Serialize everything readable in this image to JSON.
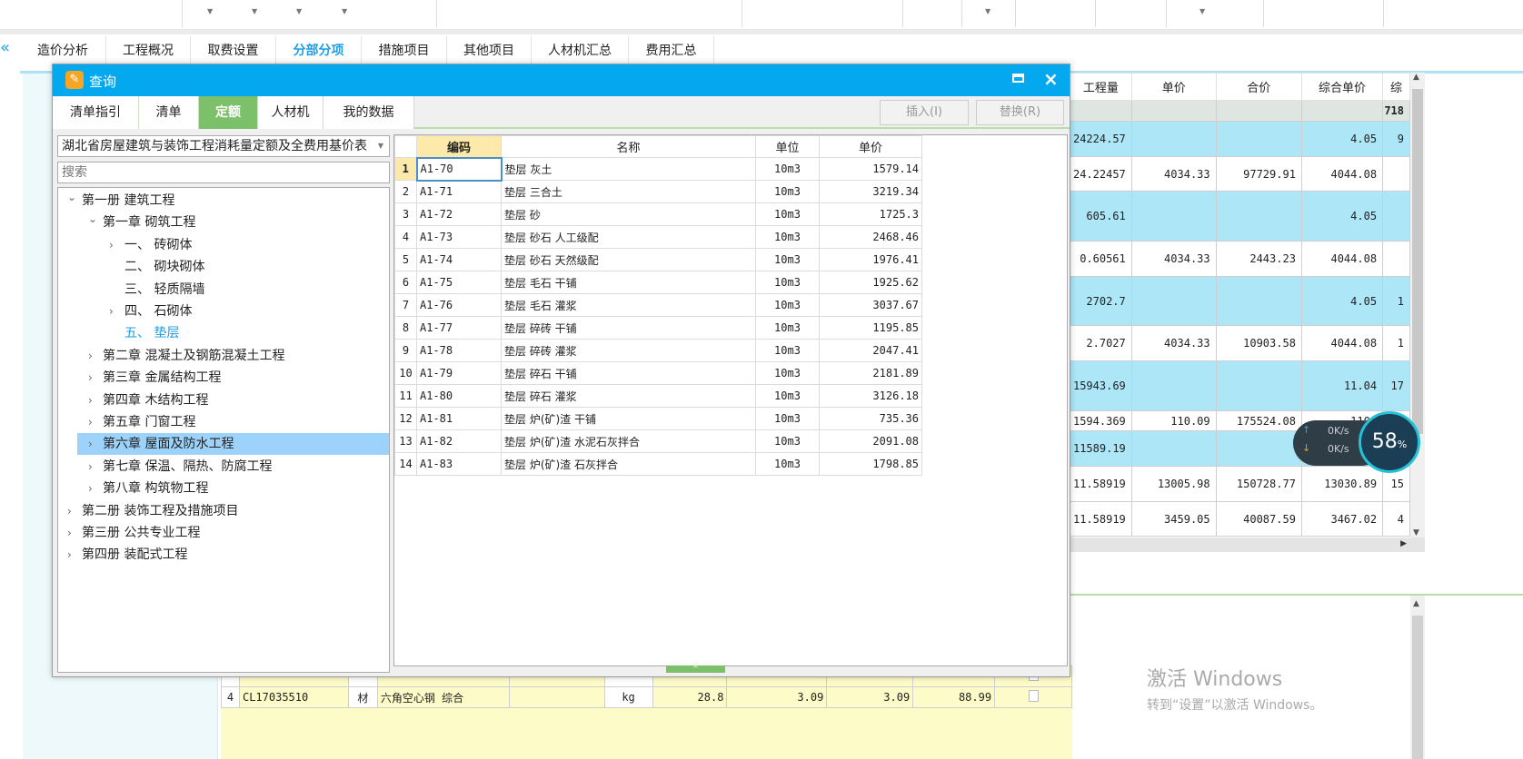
{
  "main_tabs": [
    "造价分析",
    "工程概况",
    "取费设置",
    "分部分项",
    "措施项目",
    "其他项目",
    "人材机汇总",
    "费用汇总"
  ],
  "active_main_tab": "分部分项",
  "right_table": {
    "headers": [
      "工程量",
      "单价",
      "合价",
      "综合单价",
      "综"
    ],
    "rows": [
      {
        "style": "g",
        "cells": [
          "",
          "",
          "",
          "",
          "718"
        ]
      },
      {
        "style": "b",
        "cells": [
          "24224.57",
          "",
          "",
          "4.05",
          "9"
        ]
      },
      {
        "style": "w",
        "cells": [
          "24.22457",
          "4034.33",
          "97729.91",
          "4044.08",
          ""
        ]
      },
      {
        "style": "b",
        "cells": [
          "605.61",
          "",
          "",
          "4.05",
          ""
        ]
      },
      {
        "style": "w",
        "cells": [
          "0.60561",
          "4034.33",
          "2443.23",
          "4044.08",
          ""
        ]
      },
      {
        "style": "b",
        "cells": [
          "2702.7",
          "",
          "",
          "4.05",
          "1"
        ]
      },
      {
        "style": "w",
        "cells": [
          "2.7027",
          "4034.33",
          "10903.58",
          "4044.08",
          "1"
        ]
      },
      {
        "style": "b",
        "cells": [
          "15943.69",
          "",
          "",
          "11.04",
          "17"
        ]
      },
      {
        "style": "w",
        "cells": [
          "1594.369",
          "110.09",
          "175524.08",
          "110.",
          ""
        ]
      },
      {
        "style": "b",
        "cells": [
          "11589.19",
          "",
          "",
          "",
          ""
        ]
      },
      {
        "style": "w",
        "cells": [
          "11.58919",
          "13005.98",
          "150728.77",
          "13030.89",
          "15"
        ]
      },
      {
        "style": "w",
        "cells": [
          "11.58919",
          "3459.05",
          "40087.59",
          "3467.02",
          "4"
        ]
      }
    ]
  },
  "bottom_table": {
    "rows": [
      {
        "cells": [
          "",
          "",
          "",
          "",
          "",
          "",
          "",
          "",
          "",
          ""
        ]
      },
      {
        "cells": [
          "4",
          "CL17035510",
          "材",
          "六角空心钢 综合",
          "",
          "kg",
          "28.8",
          "3.09",
          "3.09",
          "88.99"
        ]
      }
    ]
  },
  "net_monitor": {
    "upload": "0K/s",
    "download": "0K/s",
    "percent": "58",
    "percent_sign": "%"
  },
  "watermark": {
    "title": "激活 Windows",
    "subtitle": "转到“设置”以激活 Windows。"
  },
  "dialog": {
    "title": "查询",
    "tabs": [
      "清单指引",
      "清单",
      "定额",
      "人材机",
      "我的数据"
    ],
    "active_tab": "定额",
    "insert_button": "插入(I)",
    "replace_button": "替换(R)",
    "library_select": "湖北省房屋建筑与装饰工程消耗量定额及全费用基价表",
    "search_placeholder": "搜索",
    "tree": [
      {
        "level": 0,
        "expanded": true,
        "hasChildren": true,
        "label": "第一册 建筑工程"
      },
      {
        "level": 1,
        "expanded": true,
        "hasChildren": true,
        "label": "第一章 砌筑工程"
      },
      {
        "level": 2,
        "hasChildren": true,
        "label": "一、 砖砌体"
      },
      {
        "level": 2,
        "hasChildren": false,
        "label": "二、 砌块砌体"
      },
      {
        "level": 2,
        "hasChildren": false,
        "label": "三、 轻质隔墙"
      },
      {
        "level": 2,
        "hasChildren": true,
        "label": "四、 石砌体"
      },
      {
        "level": 2,
        "hasChildren": false,
        "current": true,
        "label": "五、 垫层"
      },
      {
        "level": 1,
        "hasChildren": true,
        "label": "第二章 混凝土及钢筋混凝土工程"
      },
      {
        "level": 1,
        "hasChildren": true,
        "label": "第三章 金属结构工程"
      },
      {
        "level": 1,
        "hasChildren": true,
        "label": "第四章 木结构工程"
      },
      {
        "level": 1,
        "hasChildren": true,
        "label": "第五章 门窗工程"
      },
      {
        "level": 1,
        "hasChildren": true,
        "selected": true,
        "label": "第六章 屋面及防水工程"
      },
      {
        "level": 1,
        "hasChildren": true,
        "label": "第七章 保温、隔热、防腐工程"
      },
      {
        "level": 1,
        "hasChildren": true,
        "label": "第八章 构筑物工程"
      },
      {
        "level": 0,
        "hasChildren": true,
        "label": "第二册 装饰工程及措施项目"
      },
      {
        "level": 0,
        "hasChildren": true,
        "label": "第三册 公共专业工程"
      },
      {
        "level": 0,
        "hasChildren": true,
        "label": "第四册 装配式工程"
      }
    ],
    "grid": {
      "headers": [
        "编码",
        "名称",
        "单位",
        "单价"
      ],
      "rows": [
        [
          "1",
          "A1-70",
          "垫层 灰土",
          "10m3",
          "1579.14"
        ],
        [
          "2",
          "A1-71",
          "垫层 三合土",
          "10m3",
          "3219.34"
        ],
        [
          "3",
          "A1-72",
          "垫层 砂",
          "10m3",
          "1725.3"
        ],
        [
          "4",
          "A1-73",
          "垫层 砂石 人工级配",
          "10m3",
          "2468.46"
        ],
        [
          "5",
          "A1-74",
          "垫层 砂石 天然级配",
          "10m3",
          "1976.41"
        ],
        [
          "6",
          "A1-75",
          "垫层 毛石 干铺",
          "10m3",
          "1925.62"
        ],
        [
          "7",
          "A1-76",
          "垫层 毛石 灌浆",
          "10m3",
          "3037.67"
        ],
        [
          "8",
          "A1-77",
          "垫层 碎砖 干铺",
          "10m3",
          "1195.85"
        ],
        [
          "9",
          "A1-78",
          "垫层 碎砖 灌浆",
          "10m3",
          "2047.41"
        ],
        [
          "10",
          "A1-79",
          "垫层 碎石 干铺",
          "10m3",
          "2181.89"
        ],
        [
          "11",
          "A1-80",
          "垫层 碎石 灌浆",
          "10m3",
          "3126.18"
        ],
        [
          "12",
          "A1-81",
          "垫层 炉(矿)渣 干铺",
          "10m3",
          "735.36"
        ],
        [
          "13",
          "A1-82",
          "垫层 炉(矿)渣 水泥石灰拌合",
          "10m3",
          "2091.08"
        ],
        [
          "14",
          "A1-83",
          "垫层 炉(矿)渣 石灰拌合",
          "10m3",
          "1798.85"
        ]
      ]
    }
  },
  "colors": {
    "title_bar": "#04a8ee",
    "active_tab_green": "#7dc06a",
    "selected_row": "#9dd3fa",
    "row_blue": "#ace6f7",
    "bottom_yellow": "#fdfbc8"
  }
}
